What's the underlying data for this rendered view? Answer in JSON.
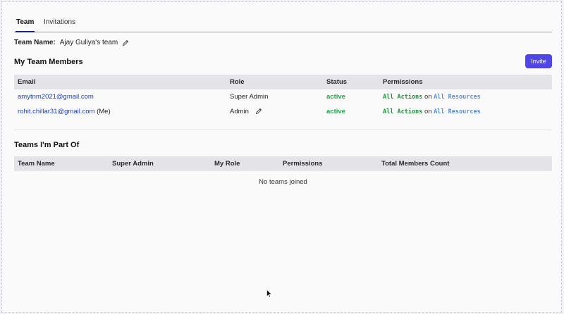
{
  "tabs": [
    {
      "label": "Team",
      "active": true
    },
    {
      "label": "Invitations",
      "active": false
    }
  ],
  "team": {
    "name_label": "Team Name:",
    "name_value": "Ajay Guliya's team"
  },
  "members": {
    "title": "My Team Members",
    "invite_label": "Invite",
    "columns": [
      "Email",
      "Role",
      "Status",
      "Permissions"
    ],
    "rows": [
      {
        "email": "amytnm2021@gmail.com",
        "me": "",
        "role": "Super Admin",
        "status": "active",
        "perm_action": "All Actions",
        "perm_on": "on",
        "perm_resource": "All Resources"
      },
      {
        "email": "rohit.chillar31@gmail.com",
        "me": "(Me)",
        "role": "Admin",
        "status": "active",
        "perm_action": "All Actions",
        "perm_on": "on",
        "perm_resource": "All Resources"
      }
    ]
  },
  "teams_part_of": {
    "title": "Teams I'm Part Of",
    "columns": [
      "Team Name",
      "Super Admin",
      "My Role",
      "Permissions",
      "Total Members Count"
    ],
    "empty_message": "No teams joined"
  },
  "colors": {
    "accent": "#4f46e5",
    "active_status": "#22a34a",
    "link": "#1d3fbf"
  }
}
